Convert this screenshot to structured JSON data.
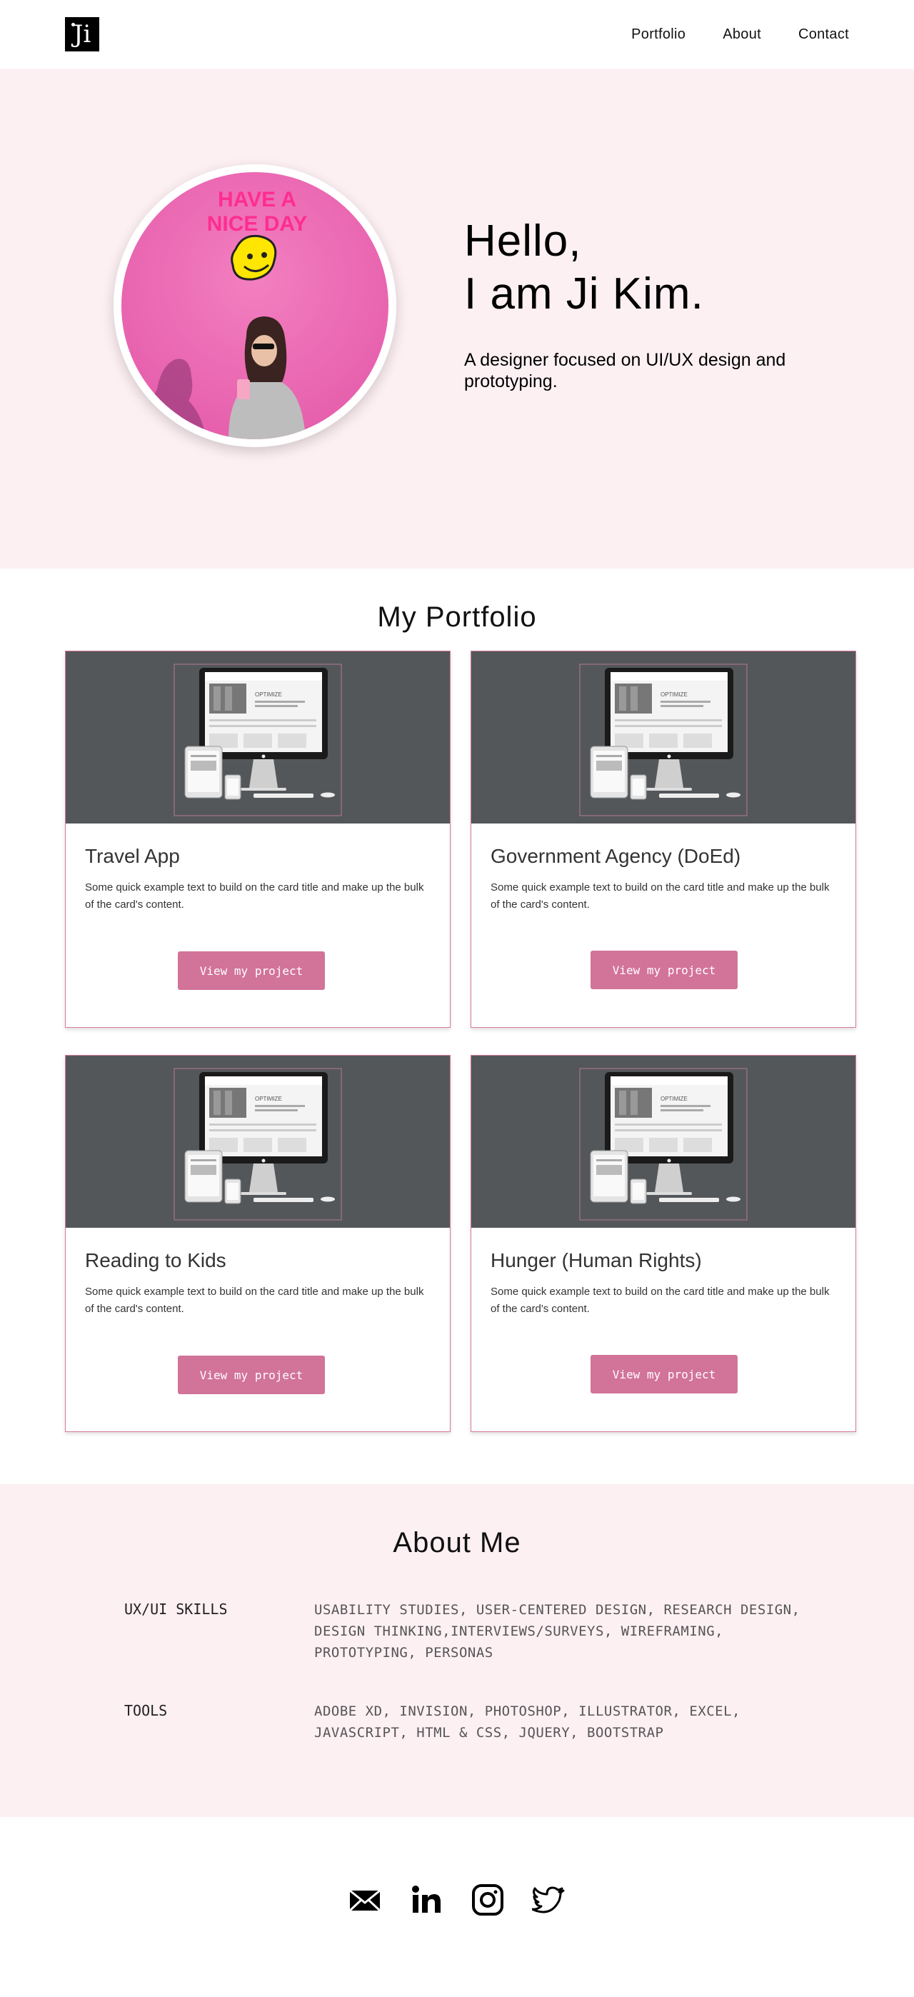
{
  "nav": {
    "logo_text": "Ji",
    "links": [
      "Portfolio",
      "About",
      "Contact"
    ]
  },
  "hero": {
    "title_line1": "Hello,",
    "title_line2": "I am Ji Kim.",
    "subtitle": "A designer focused on UI/UX design and prototyping.",
    "photo_sign_line1": "HAVE A",
    "photo_sign_line2": "NICE DAY"
  },
  "portfolio": {
    "title": "My Portfolio",
    "cards": [
      {
        "title": "Travel App",
        "text": "Some quick example text to build on the card title and make up the bulk of the card's content.",
        "button": "View my project"
      },
      {
        "title": "Government Agency (DoEd)",
        "text": "Some quick example text to build on the card title and make up the bulk of the card's content.",
        "button": "View my project"
      },
      {
        "title": "Reading to Kids",
        "text": "Some quick example text to build on the card title and make up the bulk of the card's content.",
        "button": "View my project"
      },
      {
        "title": "Hunger (Human Rights)",
        "text": "Some quick example text to build on the card title and make up the bulk of the card's content.",
        "button": "View my project"
      }
    ],
    "mockup_brand": "OPTIMIZE"
  },
  "about": {
    "title": "About Me",
    "skills_label": "UX/UI SKILLS",
    "skills_value": "USABILITY STUDIES, USER-CENTERED DESIGN, RESEARCH DESIGN, DESIGN THINKING,INTERVIEWS/SURVEYS, WIREFRAMING, PROTOTYPING, PERSONAS",
    "tools_label": "TOOLS",
    "tools_value": "ADOBE XD, INVISION, PHOTOSHOP, ILLUSTRATOR, EXCEL, JAVASCRIPT, HTML & CSS, JQUERY, BOOTSTRAP"
  },
  "footer": {
    "icons": [
      "mail-icon",
      "linkedin-icon",
      "instagram-icon",
      "twitter-icon"
    ]
  },
  "colors": {
    "pink_bg": "#fdf0f3",
    "button": "#d27399",
    "card_border": "#d67a98",
    "card_image_bg": "#54575a"
  }
}
